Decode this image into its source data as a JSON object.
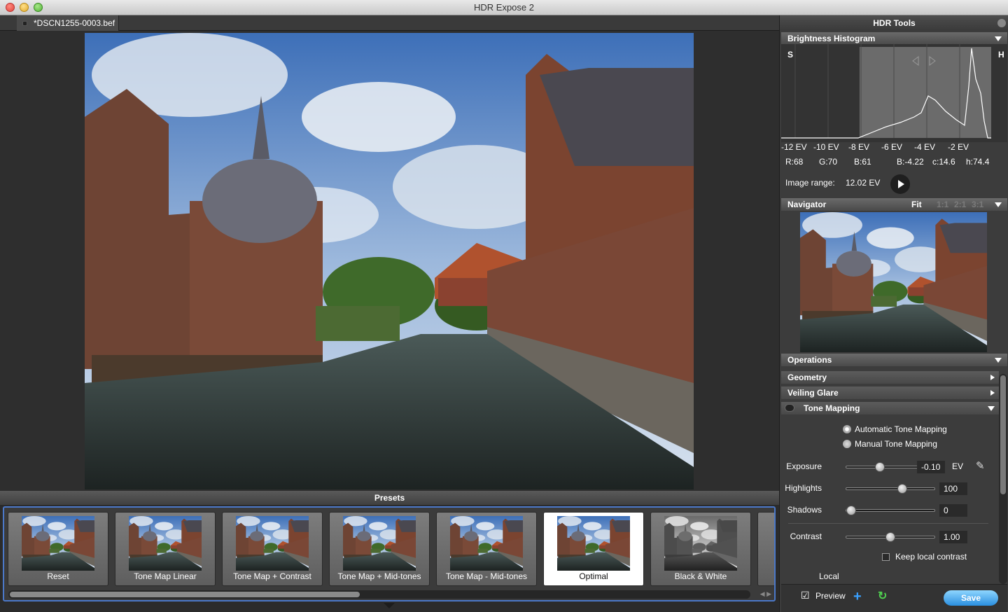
{
  "window": {
    "title": "HDR Expose 2"
  },
  "document_tab": {
    "label": "*DSCN1255-0003.bef"
  },
  "presets": {
    "header": "Presets",
    "items": [
      {
        "label": "Reset",
        "selected": false
      },
      {
        "label": "Tone Map Linear",
        "selected": false
      },
      {
        "label": "Tone Map + Contrast",
        "selected": false
      },
      {
        "label": "Tone Map + Mid-tones",
        "selected": false
      },
      {
        "label": "Tone Map - Mid-tones",
        "selected": false
      },
      {
        "label": "Optimal",
        "selected": true
      },
      {
        "label": "Black & White",
        "selected": false
      }
    ]
  },
  "hdr_tools": {
    "title": "HDR Tools",
    "histogram": {
      "header": "Brightness Histogram",
      "left_marker": "S",
      "right_marker": "H",
      "ev_labels": [
        "-12 EV",
        "-10 EV",
        "-8 EV",
        "-6 EV",
        "-4 EV",
        "-2 EV"
      ],
      "readout": {
        "r": "R:68",
        "g": "G:70",
        "b": "B:61",
        "b_ev": "B:-4.22",
        "c": "c:14.6",
        "h": "h:74.4"
      },
      "image_range_label": "Image range:",
      "image_range_value": "12.02 EV"
    },
    "navigator": {
      "header": "Navigator",
      "fit": "Fit",
      "zoom_1": "1:1",
      "zoom_2": "2:1",
      "zoom_3": "3:1"
    },
    "operations": {
      "header": "Operations",
      "geometry": "Geometry",
      "veiling_glare": "Veiling Glare",
      "tone_mapping": "Tone Mapping",
      "auto_tm": "Automatic Tone Mapping",
      "manual_tm": "Manual Tone Mapping",
      "exposure": {
        "label": "Exposure",
        "value": "-0.10",
        "unit": "EV",
        "fraction": 0.37
      },
      "highlights": {
        "label": "Highlights",
        "value": "100",
        "fraction": 0.65
      },
      "shadows": {
        "label": "Shadows",
        "value": "0",
        "fraction": 0.0
      },
      "contrast": {
        "label": "Contrast",
        "value": "1.00",
        "fraction": 0.5
      },
      "keep_local_contrast": "Keep local contrast",
      "local": "Local"
    },
    "footer": {
      "preview": "Preview",
      "save": "Save"
    }
  },
  "colors": {
    "accent": "#2a8fe0",
    "selection_border": "#4b78c8"
  }
}
